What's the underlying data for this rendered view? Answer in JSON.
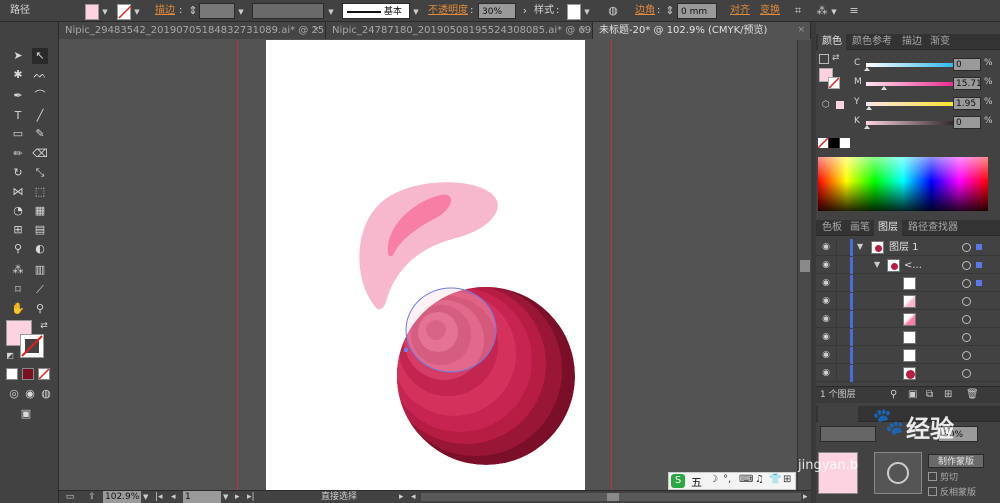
{
  "control_bar": {
    "path_label": "路径",
    "stroke_label": "描边",
    "stroke_style": "基本",
    "opacity_label": "不透明度",
    "opacity_value": "30%",
    "style_label": "样式",
    "corner_label": "边角",
    "corner_value": "0 mm",
    "align_label": "对齐",
    "transform_label": "变换",
    "fill_color": "#fdd3e2"
  },
  "tabs": [
    {
      "label": "Nipic_29483542_20190705184832731089.ai* @ 25..."
    },
    {
      "label": "Nipic_24787180_20190508195524308085.ai* @ 69..."
    },
    {
      "label": "未标题-20* @ 102.9% (CMYK/预览)"
    }
  ],
  "tab_close": "×",
  "status": {
    "zoom": "102.9%",
    "page": "1",
    "tool_name": "直接选择"
  },
  "color_panel": {
    "tabs": [
      "颜色",
      "颜色参考",
      "描边",
      "渐变"
    ],
    "channels": [
      {
        "label": "C",
        "value": "0",
        "level": 0.0
      },
      {
        "label": "M",
        "value": "15.71",
        "level": 0.157
      },
      {
        "label": "Y",
        "value": "1.95",
        "level": 0.02
      },
      {
        "label": "K",
        "value": "0",
        "level": 0.0
      }
    ],
    "pct": "%"
  },
  "layers_panel": {
    "tabs": [
      "色板",
      "画笔",
      "图层",
      "路径查找器"
    ],
    "layer_name": "图层 1",
    "group_name": "<...",
    "footer": "1 个图层"
  },
  "transparency_panel": {
    "opacity_value": "30%",
    "mask_button": "制作蒙版",
    "clip_label": "剪切",
    "invert_label": "反相蒙版"
  },
  "ime_bar": {
    "mode": "五"
  },
  "watermark": {
    "text": "经验",
    "url_text": "jingyan.b"
  }
}
